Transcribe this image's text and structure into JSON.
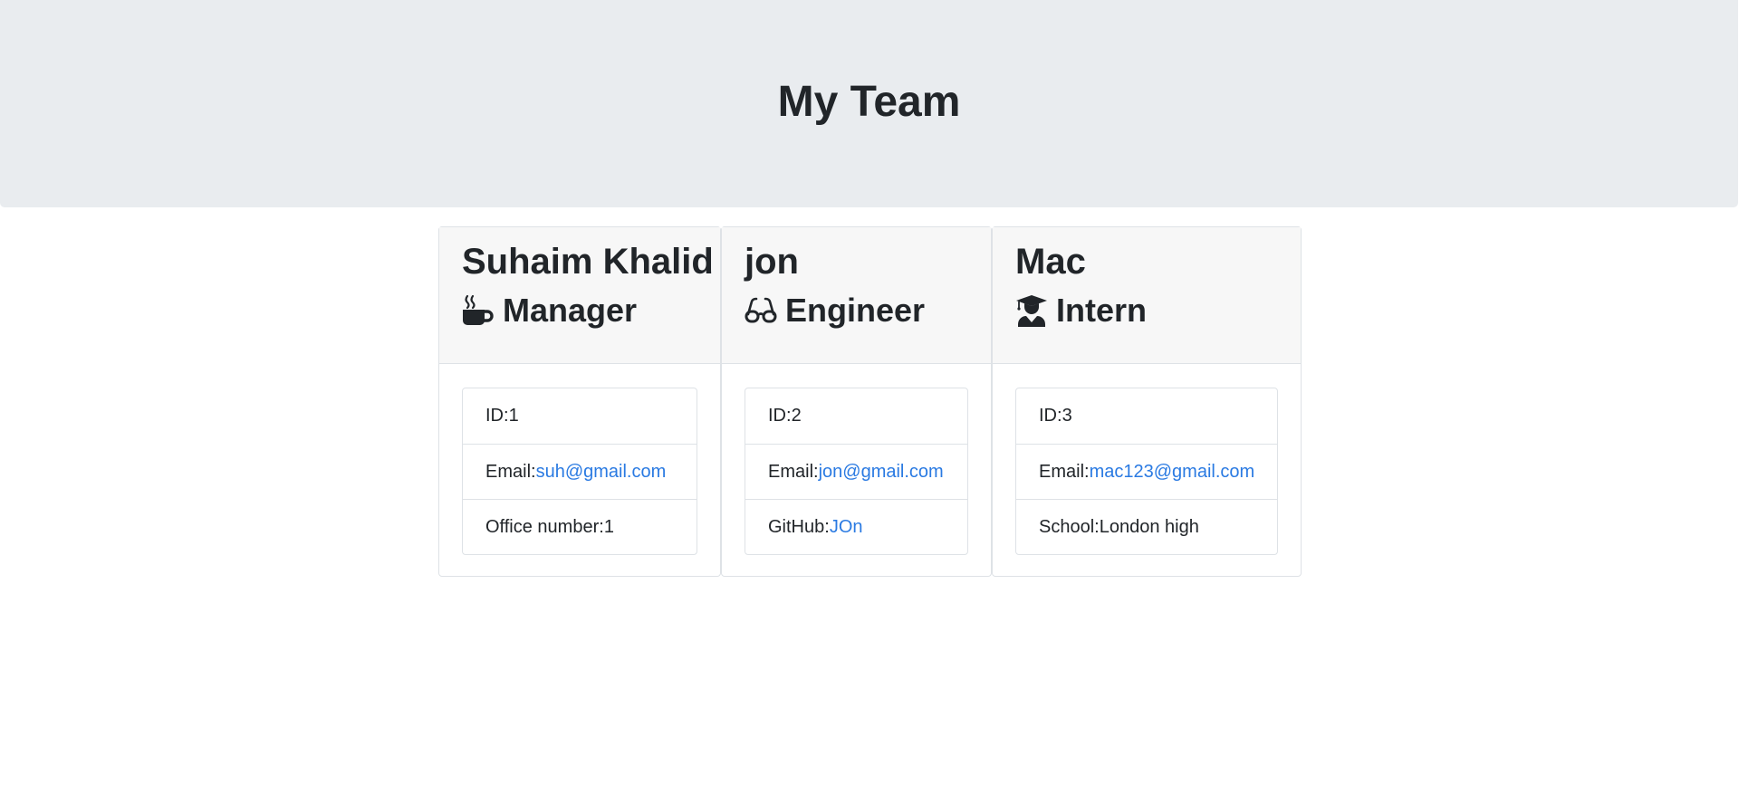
{
  "header": {
    "title": "My Team"
  },
  "cards": [
    {
      "name": "Suhaim Khalid",
      "role": "Manager",
      "role_icon": "coffee-mug-icon",
      "id_label": "ID: ",
      "id_value": "1",
      "email_label": "Email: ",
      "email": "suh@gmail.com",
      "extra_label": "Office number: ",
      "extra_value": "1"
    },
    {
      "name": "jon",
      "role": "Engineer",
      "role_icon": "glasses-icon",
      "id_label": "ID: ",
      "id_value": "2",
      "email_label": "Email: ",
      "email": "jon@gmail.com",
      "extra_label": "GitHub: ",
      "extra_value": "JOn"
    },
    {
      "name": "Mac",
      "role": "Intern",
      "role_icon": "graduate-icon",
      "id_label": "ID: ",
      "id_value": "3",
      "email_label": "Email: ",
      "email": "mac123@gmail.com",
      "extra_label": "School: ",
      "extra_value": "London high"
    }
  ],
  "colors": {
    "header_bg": "#e9ecef",
    "card_header_bg": "#f7f7f7",
    "link": "#2a7ae2",
    "text": "#212529",
    "border": "#dee2e6"
  }
}
